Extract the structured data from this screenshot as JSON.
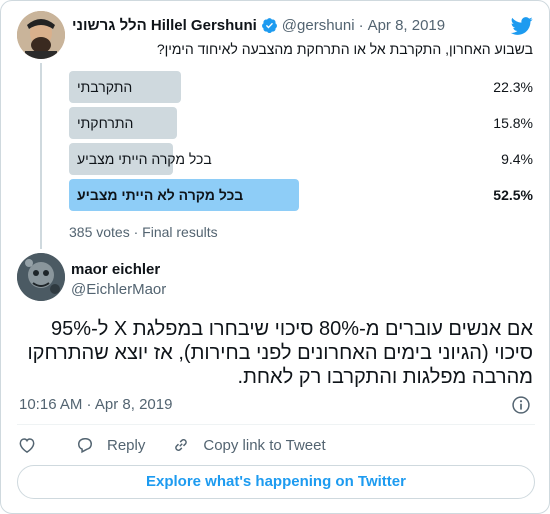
{
  "quoted_tweet": {
    "author_name": "הלל גרשוני Hillel Gershuni",
    "handle": "@gershuni",
    "separator": "·",
    "date": "Apr 8, 2019",
    "text": "בשבוע האחרון, התקרבת אל או התרחקת מהצבעה לאיחוד הימין?",
    "avatar_icon": "person-photo",
    "verified_icon": "verified-badge-icon",
    "brand_icon": "twitter-bird-icon"
  },
  "poll": {
    "options": [
      {
        "label": "התקרבתי",
        "percent_text": "22.3%",
        "percent": 22.3,
        "winner": false
      },
      {
        "label": "התרחקתי",
        "percent_text": "15.8%",
        "percent": 15.8,
        "winner": false
      },
      {
        "label": "בכל מקרה הייתי מצביע",
        "percent_text": "9.4%",
        "percent": 9.4,
        "winner": false
      },
      {
        "label": "בכל מקרה לא הייתי מצביע",
        "percent_text": "52.5%",
        "percent": 52.5,
        "winner": true
      }
    ],
    "footer": "385 votes · Final results"
  },
  "tweet": {
    "author_name": "maor eichler",
    "handle": "@EichlerMaor",
    "text": "אם אנשים עוברים מ-80% סיכוי שיבחרו במפלגת X ל-95% סיכוי (הגיוני בימים האחרונים לפני בחירות), אז יוצא שהתרחקו מהרבה מפלגות והתקרבו רק לאחת.",
    "time": "10:16 AM · Apr 8, 2019",
    "avatar_icon": "person-photo"
  },
  "actions": {
    "like_label": "",
    "reply_label": "Reply",
    "copy_label": "Copy link to Tweet"
  },
  "explore_label": "Explore what's happening on Twitter",
  "colors": {
    "accent": "#1d9bf0",
    "poll_bar": "#cfd9de",
    "poll_bar_winner": "#8ecdf7",
    "muted_text": "#536471"
  }
}
